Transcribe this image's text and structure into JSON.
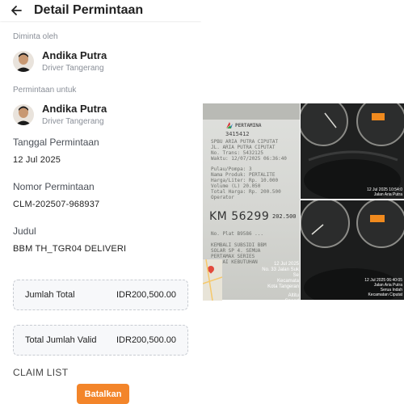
{
  "header": {
    "title": "Detail Permintaan"
  },
  "requested_by": {
    "label": "Diminta oleh",
    "name": "Andika Putra",
    "role": "Driver Tangerang"
  },
  "requested_for": {
    "label": "Permintaan untuk",
    "name": "Andika Putra",
    "role": "Driver Tangerang"
  },
  "request_date": {
    "label": "Tanggal Permintaan",
    "value": "12 Jul 2025"
  },
  "request_number": {
    "label": "Nomor Permintaan",
    "value": "CLM-202507-968937"
  },
  "subject": {
    "label": "Judul",
    "value": "BBM TH_TGR04 DELIVERI"
  },
  "total": {
    "label": "Jumlah Total",
    "value": "IDR200,500.00"
  },
  "total_valid": {
    "label": "Total Jumlah Valid",
    "value": "IDR200,500.00"
  },
  "claim_list": {
    "label": "CLAIM LIST"
  },
  "cancel_button": {
    "label": "Batalkan"
  },
  "colors": {
    "accent": "#f3852a",
    "text": "#222222",
    "muted": "#8a8f98"
  },
  "icons": {
    "back": "arrow-left-icon"
  },
  "gallery": {
    "receipt": {
      "brand": "PERTAMINA",
      "station_no": "3415412",
      "lines": [
        "SPBU ARIA PUTRA CIPUTAT",
        "JL. ARIA PUTRA CIPUTAT",
        "No. Trans: 5432125",
        "Waktu: 12/07/2025 06:36:40",
        "Pulau/Pompa: 3",
        "Nama Produk: PERTALITE",
        "Harga/Liter: Rp. 10.000",
        "Volume   (L) 20.050",
        "Total Harga: Rp. 200.500",
        "Operator"
      ],
      "km_note": "KM 56299",
      "price_note": "202.500",
      "plate_line": "No. Plat  B9586 ...",
      "footer_lines": [
        "KEMBALI SUBSIDI BBM",
        "SOLAR SP 4. SEMUA",
        "PERTAMAX SERIES",
        "SESUAI KEBUTUHAN"
      ]
    },
    "photo1": {
      "timestamp": "12 Jul 2025 10:54:0",
      "address": "Jalan Aria Putra",
      "city": "Kota Tangerang"
    },
    "location_overlay": {
      "date": "12 Jul 2025",
      "street": "No. 33 Jalan Suk",
      "line2": "Se",
      "district": "Kecamata",
      "city": "Kota Tangeran",
      "altitude": "Altitu",
      "speed": "Speed"
    },
    "photo2": {
      "timestamp": "12 Jul 2025 06:40:05",
      "street": "Jalan Aria Putra",
      "area": "Serua Indah",
      "district": "Kecamatan Ciputat"
    }
  }
}
